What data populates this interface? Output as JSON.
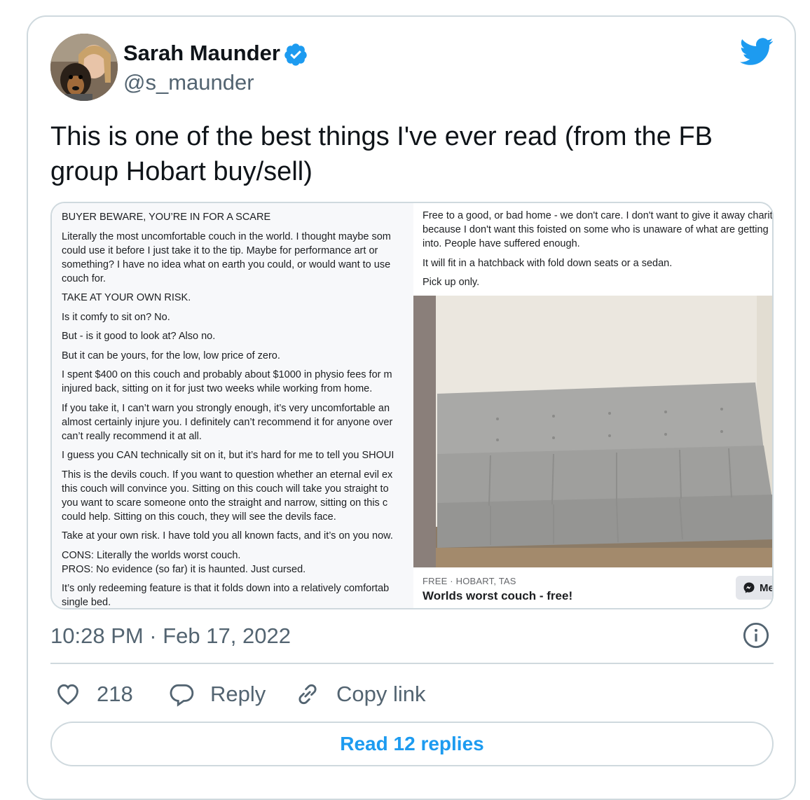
{
  "colors": {
    "accent": "#1d9bf0",
    "text": "#0f1419",
    "muted": "#536471",
    "border": "#cfd9de"
  },
  "author": {
    "name": "Sarah Maunder",
    "handle": "@s_maunder",
    "verified_icon": "verified-badge-icon"
  },
  "tweet": {
    "text": "This is one of the best things I've ever read (from the FB group Hobart buy/sell)"
  },
  "listing": {
    "left_paragraphs": [
      "BUYER BEWARE, YOU’RE IN FOR A SCARE",
      "Literally the most uncomfortable couch in the world. I thought maybe som\ncould use it before I just take it to the tip. Maybe for performance art or\nsomething? I have no idea what on earth you could, or would want to use \ncouch for.",
      "TAKE AT YOUR OWN RISK.",
      "Is it comfy to sit on? No.",
      "But - is it good to look at? Also no.",
      "But it can be yours, for the low, low price of zero.",
      "I spent $400 on this couch and probably about $1000 in physio fees for m\ninjured back, sitting on it for just two weeks while working from home.",
      "If you take it, I can’t warn you strongly enough, it’s very uncomfortable an\nalmost certainly injure you. I definitely can’t recommend it for anyone over\ncan’t really recommend it at all.",
      "I guess you CAN technically sit on it, but it’s hard for me to tell you SHOUI",
      "This is the devils couch.  If you want to question whether an eternal evil ex\nthis couch will convince you.  Sitting on this couch will take you straight to\nyou want to scare someone onto the  straight and narrow, sitting on this c\ncould help.  Sitting on this couch, they will see the devils face.",
      "Take at your own risk. I have told you all known facts, and it’s on you now.",
      "CONS:  Literally the worlds worst couch.\nPROS:  No evidence (so far) it is haunted.  Just cursed.",
      "It’s only redeeming feature is that it folds down into a relatively comfortab\nsingle bed."
    ],
    "right_paragraphs": [
      "Free to a good, or bad home - we don't care.  I don't want to give it away \ncharity, because I don't want this foisted on some who is unaware of what\nare getting into.  People have suffered enough.",
      "It will fit in a hatchback with fold down seats or a sedan.",
      "Pick up only."
    ],
    "meta": "FREE · HOBART, TAS",
    "title": "Worlds worst couch - free!",
    "messenger_label": "Me"
  },
  "timestamp": "10:28 PM · Feb 17, 2022",
  "actions": {
    "likes": "218",
    "reply": "Reply",
    "copy_link": "Copy link"
  },
  "read_replies": "Read 12 replies"
}
